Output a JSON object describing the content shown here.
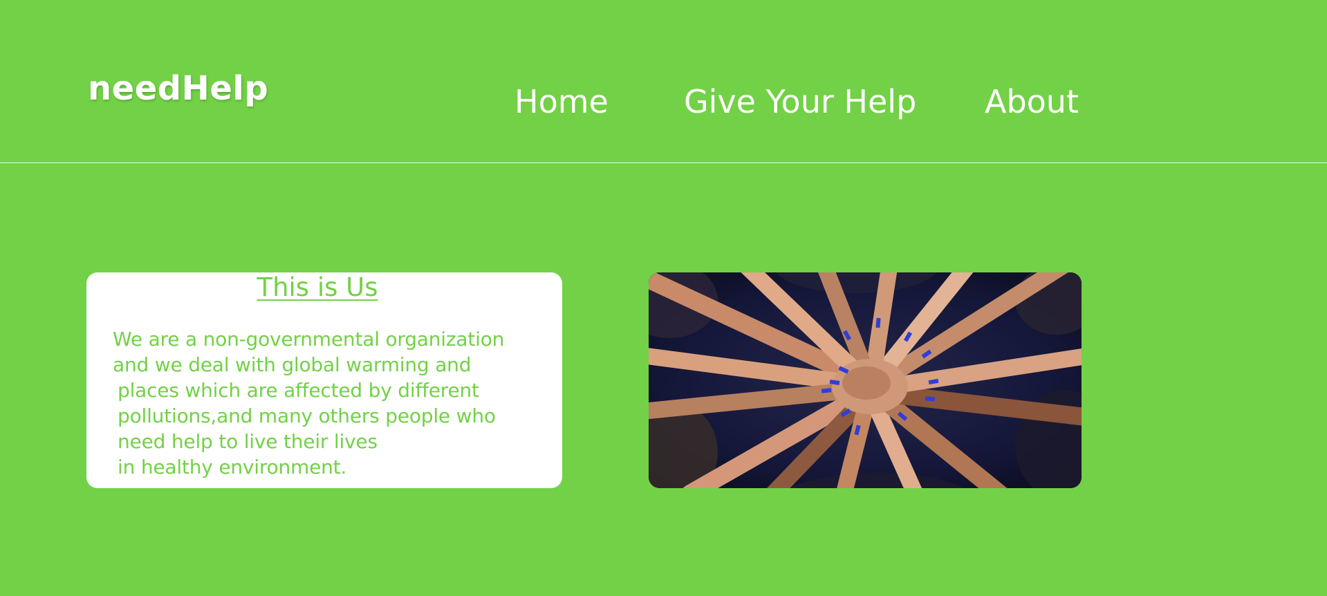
{
  "header": {
    "logo": "needHelp",
    "nav": [
      {
        "label": "Home"
      },
      {
        "label": "Give Your Help"
      },
      {
        "label": "About"
      }
    ]
  },
  "main": {
    "card": {
      "title": "This is Us",
      "lines": [
        "We are a non-governmental organization",
        "and we deal with global warming and",
        "places which are affected by different",
        "pollutions,and many others people who",
        "need help to live their lives",
        "in healthy environment."
      ]
    },
    "image": {
      "subject": "hands-together-photo"
    }
  },
  "colors": {
    "background": "#72d146",
    "card": "#ffffff",
    "text_light": "#ffffff",
    "text_green": "#72d146"
  }
}
